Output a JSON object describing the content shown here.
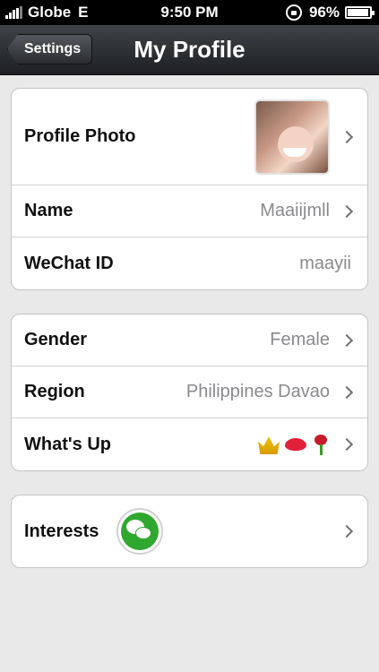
{
  "status_bar": {
    "carrier": "Globe",
    "network": "E",
    "time": "9:50 PM",
    "battery": "96%",
    "battery_level": 0.96,
    "icons": [
      "signal-icon",
      "rotation-lock-icon",
      "battery-icon"
    ]
  },
  "nav": {
    "back_label": "Settings",
    "title": "My Profile"
  },
  "group1": [
    {
      "label": "Profile Photo",
      "value": "",
      "chevron": true
    },
    {
      "label": "Name",
      "value": "Maaiijmll",
      "chevron": true
    },
    {
      "label": "WeChat ID",
      "value": "maayii",
      "chevron": false
    }
  ],
  "group2": [
    {
      "label": "Gender",
      "value": "Female",
      "chevron": true
    },
    {
      "label": "Region",
      "value": "Philippines Davao",
      "chevron": true
    },
    {
      "label": "What's Up",
      "value_icons": [
        "crown-icon",
        "lips-icon",
        "rose-icon"
      ],
      "chevron": true
    }
  ],
  "group3": [
    {
      "label": "Interests",
      "icon": "wechat-icon",
      "chevron": true
    }
  ],
  "colors": {
    "background": "#e9e9ea",
    "nav_bar": "#2a2c30",
    "wechat_green": "#2fa82f",
    "value_text": "#8a8a8e"
  }
}
